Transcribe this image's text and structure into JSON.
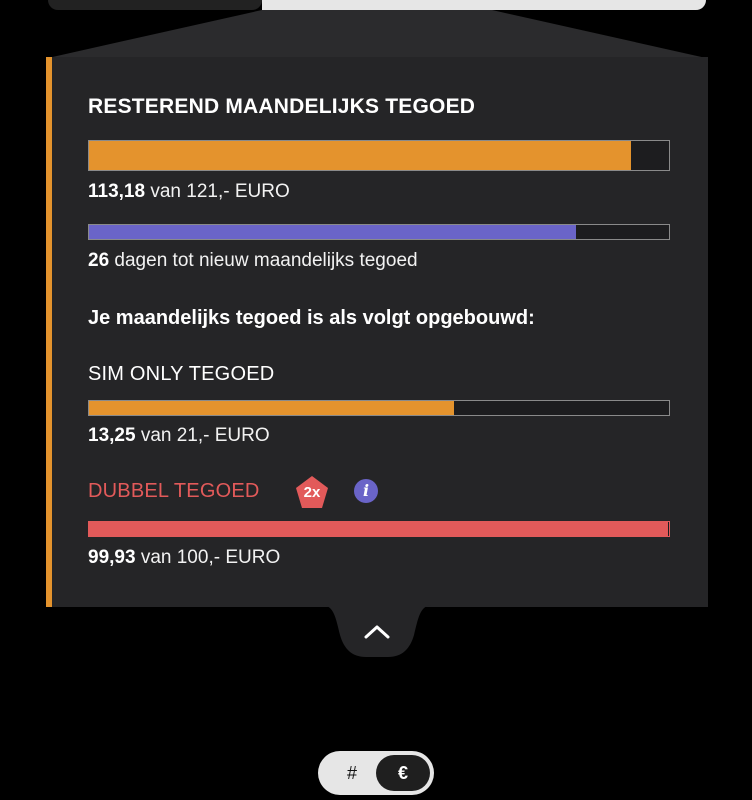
{
  "credit_panel": {
    "title": "RESTEREND MAANDELIJKS TEGOED",
    "total": {
      "amount": "113,18",
      "suffix": "van 121,- EURO",
      "fraction": 0.935
    },
    "days": {
      "count": "26",
      "suffix": "dagen tot nieuw maandelijks tegoed",
      "fraction": 0.84
    },
    "breakdown_heading": "Je maandelijks tegoed is als volgt opgebouwd:",
    "sim_only": {
      "label": "SIM ONLY TEGOED",
      "amount": "13,25",
      "suffix": "van 21,- EURO",
      "fraction": 0.63
    },
    "dubbel": {
      "label": "DUBBEL TEGOED",
      "badge": "2x",
      "info_icon": "i",
      "amount": "99,93",
      "suffix": "van 100,- EURO",
      "fraction": 0.999
    }
  },
  "toggle": {
    "hash_label": "#",
    "euro_label": "€",
    "selected": "€"
  },
  "colors": {
    "orange": "#e4932d",
    "purple": "#6a64c8",
    "red": "#e25a5a",
    "panel": "#252527"
  }
}
